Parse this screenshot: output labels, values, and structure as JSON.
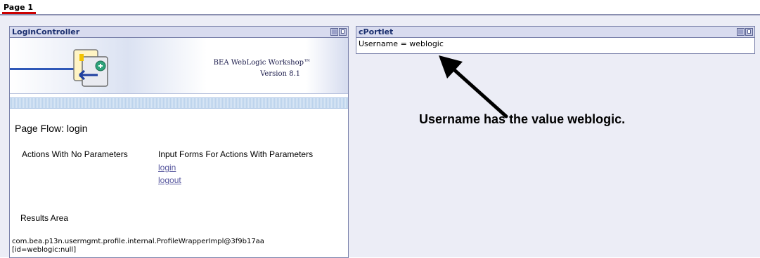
{
  "tabs": [
    {
      "label": "Page 1",
      "active": true
    }
  ],
  "colors": {
    "accent_red": "#cc0000",
    "portlet_border": "#7b82ab",
    "portlet_title_bg": "#d8dbef",
    "page_bg": "#ecedf6",
    "link": "#5a5aa0"
  },
  "login_portlet": {
    "title": "LoginController",
    "banner": {
      "brand": "BEA WebLogic Workshop™",
      "version": "Version 8.1",
      "logo_icon": "workshop-logo-icon"
    },
    "page_flow_title": "Page Flow: login",
    "no_params_header": "Actions With No Parameters",
    "params_header": "Input Forms For Actions With Parameters",
    "actions": [
      "login",
      "logout"
    ],
    "results_label": "Results Area",
    "results_lines": [
      "com.bea.p13n.usermgmt.profile.internal.ProfileWrapperImpl@3f9b17aa",
      "[id=weblogic:null]"
    ]
  },
  "c_portlet": {
    "title": "cPortlet",
    "content": "Username = weblogic"
  },
  "annotation": {
    "text": "Username has the value weblogic."
  }
}
